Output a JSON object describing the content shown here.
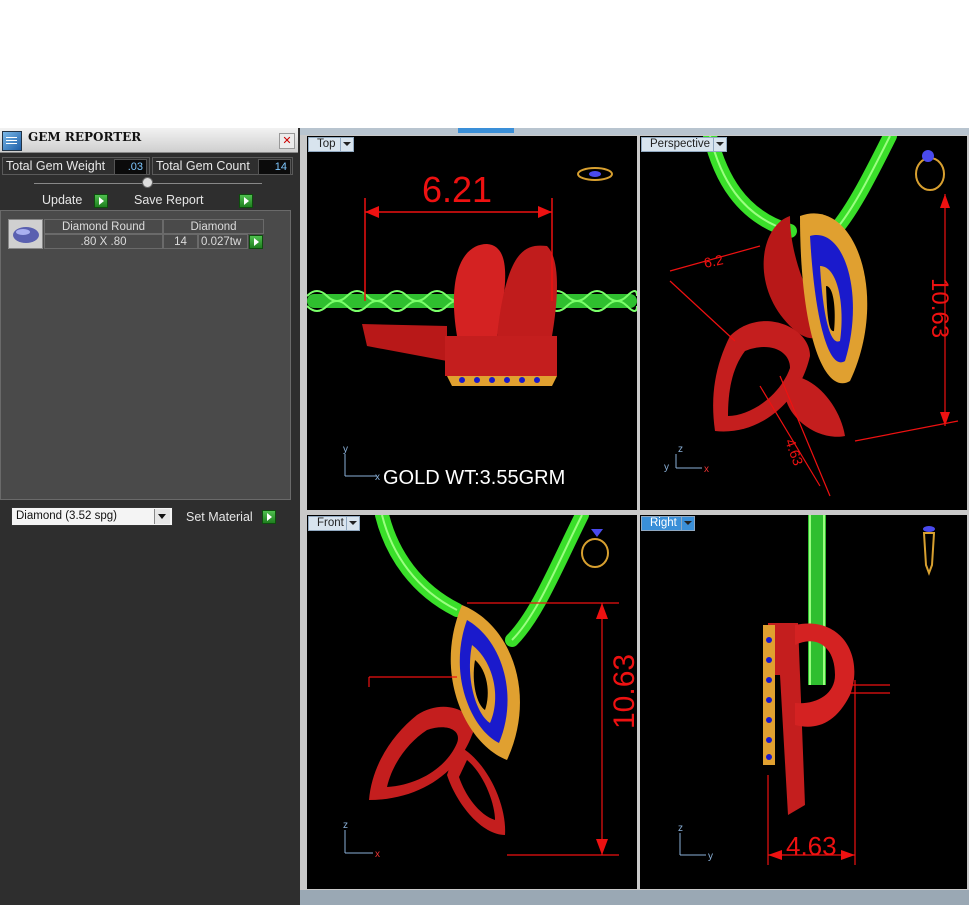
{
  "panel": {
    "title": "GEM REPORTER",
    "close_label": "✕",
    "total_weight_label": "Total Gem Weight",
    "total_weight_value": ".03",
    "total_count_label": "Total Gem Count",
    "total_count_value": "14",
    "update_label": "Update",
    "save_report_label": "Save Report",
    "table": {
      "headers": [
        "Diamond Round",
        "Diamond"
      ],
      "row": {
        "size": ".80 X .80",
        "count": "14",
        "weight": "0.027tw"
      }
    },
    "material_select": "Diamond    (3.52 spg)",
    "set_material_label": "Set Material"
  },
  "viewports": {
    "top": {
      "label": "Top",
      "dimension": "6.21",
      "annotation": "GOLD WT:3.55GRM"
    },
    "perspective": {
      "label": "Perspective",
      "dim_height": "10.63",
      "dim_width": "6.2",
      "dim_depth": "4.63"
    },
    "front": {
      "label": "Front",
      "dimension": "10.63"
    },
    "right": {
      "label": "Right",
      "dimension": "4.63"
    }
  },
  "colors": {
    "metal": "#cc1f1f",
    "chain": "#3adf2a",
    "gem": "#1a1acc",
    "prong": "#e0a030",
    "dimension": "#ee1111"
  }
}
